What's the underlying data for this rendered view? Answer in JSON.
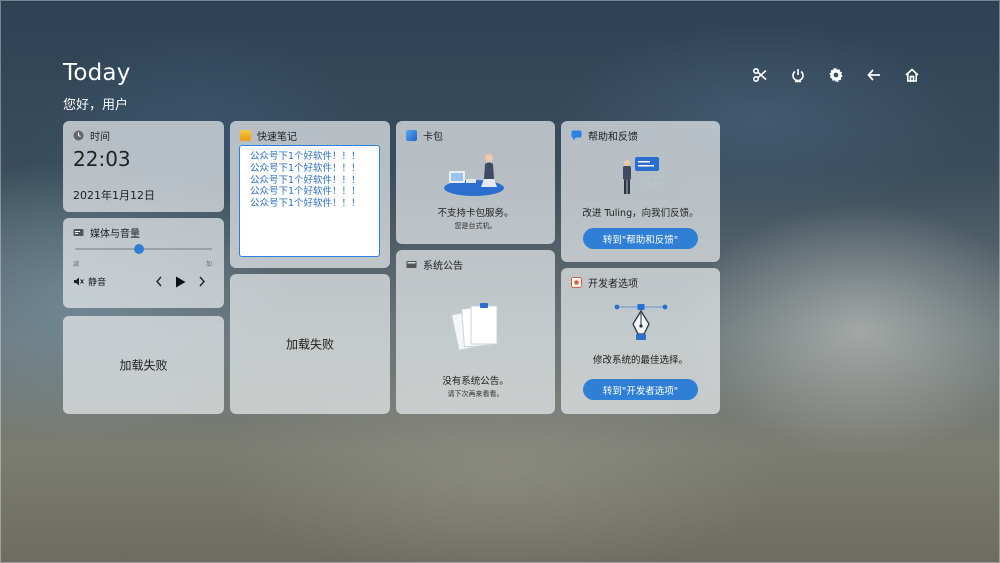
{
  "header": {
    "title": "Today",
    "greeting": "您好，用户"
  },
  "toolbar": {
    "items": [
      {
        "name": "screenshot",
        "icon": "scissors-icon"
      },
      {
        "name": "power",
        "icon": "power-icon"
      },
      {
        "name": "settings",
        "icon": "gear-icon"
      },
      {
        "name": "back",
        "icon": "arrow-left-icon"
      },
      {
        "name": "home",
        "icon": "home-icon"
      }
    ]
  },
  "time_card": {
    "title": "时间",
    "time": "22:03",
    "date": "2021年1月12日"
  },
  "media_card": {
    "title": "媒体与音量",
    "volume_level": 0.47,
    "min_label": "减",
    "max_label": "加",
    "mute_label": "静音"
  },
  "fail_card_left": {
    "text": "加载失败"
  },
  "notes_card": {
    "title": "快速笔记",
    "lines": [
      "公众号下1个好软件！！！",
      "公众号下1个好软件！！！",
      "公众号下1个好软件！！！",
      "公众号下1个好软件！！！",
      "公众号下1个好软件！！！"
    ]
  },
  "fail_card_middle": {
    "text": "加载失败"
  },
  "wallet_card": {
    "title": "卡包",
    "message": "不支持卡包服务。",
    "sub_message": "您是台式机。"
  },
  "announce_card": {
    "title": "系统公告",
    "message": "没有系统公告。",
    "sub_message": "请下次再来看看。"
  },
  "help_card": {
    "title": "帮助和反馈",
    "message": "改进 Tuling，向我们反馈。",
    "button": "转到\"帮助和反馈\""
  },
  "dev_card": {
    "title": "开发者选项",
    "message": "修改系统的最佳选择。",
    "button": "转到\"开发者选项\""
  },
  "colors": {
    "accent": "#2f7fd6",
    "card_bg": "rgba(232,234,236,0.72)"
  }
}
